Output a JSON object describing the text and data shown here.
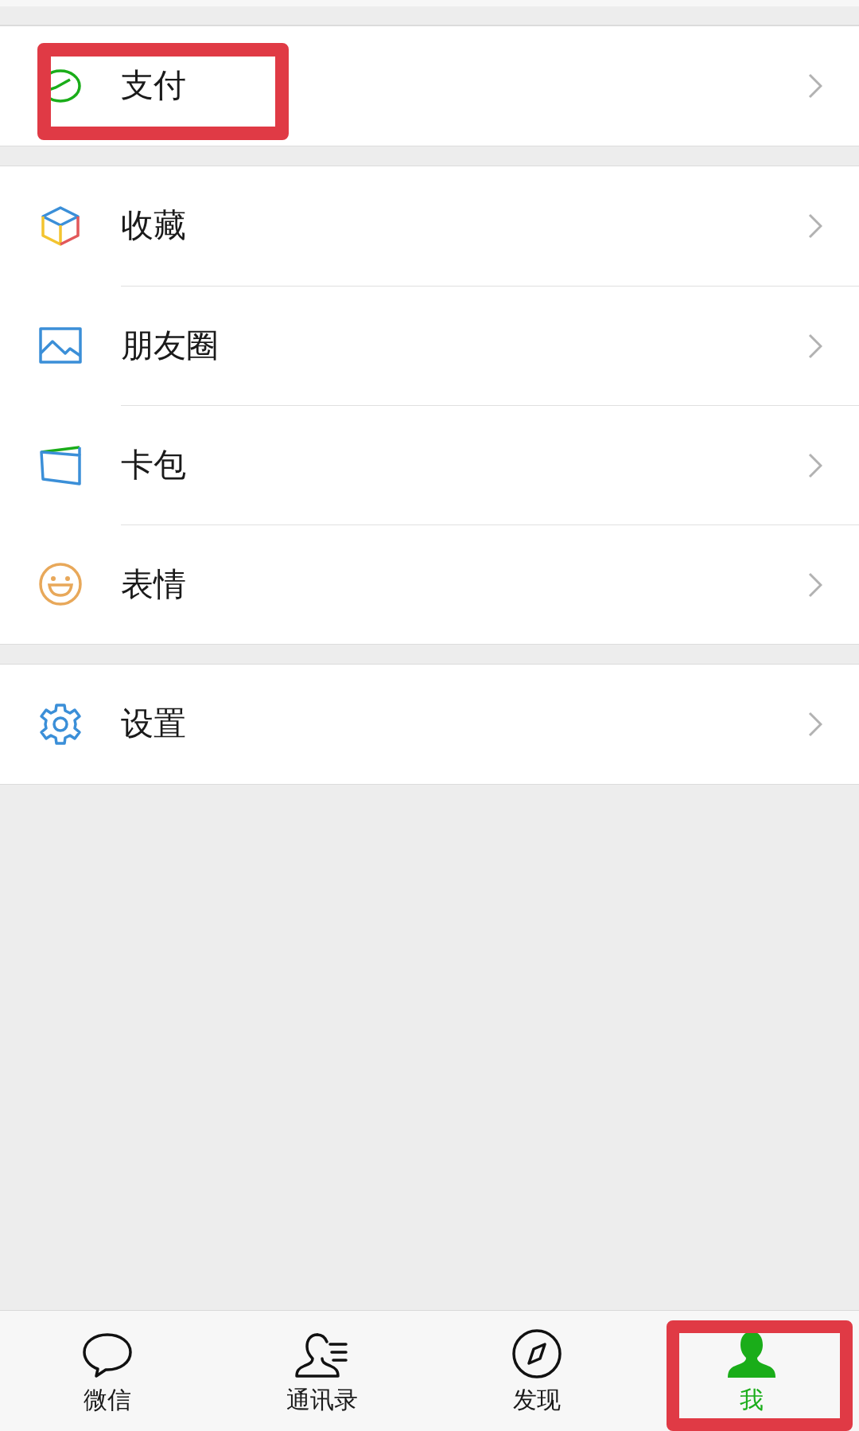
{
  "menu_groups": [
    {
      "items": [
        {
          "label": "支付",
          "highlighted": true
        }
      ]
    },
    {
      "items": [
        {
          "label": "收藏",
          "highlighted": false
        },
        {
          "label": "朋友圈",
          "highlighted": false
        },
        {
          "label": "卡包",
          "highlighted": false
        },
        {
          "label": "表情",
          "highlighted": false
        }
      ]
    },
    {
      "items": [
        {
          "label": "设置",
          "highlighted": false
        }
      ]
    }
  ],
  "tab_bar": [
    {
      "label": "微信",
      "selected": false,
      "highlighted": false
    },
    {
      "label": "通讯录",
      "selected": false,
      "highlighted": false
    },
    {
      "label": "发现",
      "selected": false,
      "highlighted": false
    },
    {
      "label": "我",
      "selected": true,
      "highlighted": true
    }
  ]
}
